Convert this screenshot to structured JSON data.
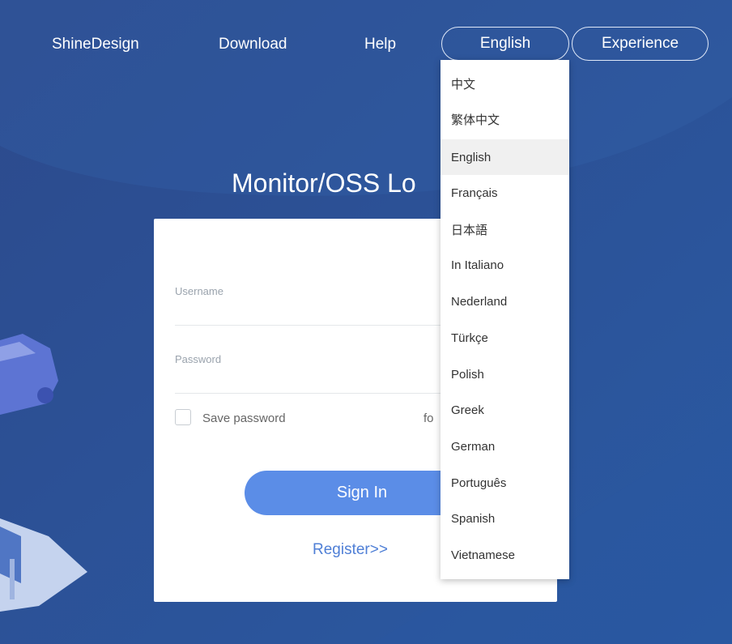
{
  "nav": {
    "brand": "ShineDesign",
    "download": "Download",
    "help": "Help",
    "language": "English",
    "experience": "Experience"
  },
  "login": {
    "title_visible": "Monitor/OSS Lo",
    "username_placeholder": "Username",
    "password_placeholder": "Password",
    "save_password": "Save password",
    "forgot_partial": "fo",
    "sign_in": "Sign In",
    "register": "Register>>"
  },
  "language_menu": {
    "selected": "English",
    "items": [
      "中文",
      "繁体中文",
      "English",
      "Français",
      "日本語",
      "In Italiano",
      "Nederland",
      "Türkçe",
      "Polish",
      "Greek",
      "German",
      "Português",
      "Spanish",
      "Vietnamese"
    ]
  },
  "colors": {
    "background": "#2c4f93",
    "primary_button": "#5b8de7",
    "link": "#4f7fd6"
  }
}
